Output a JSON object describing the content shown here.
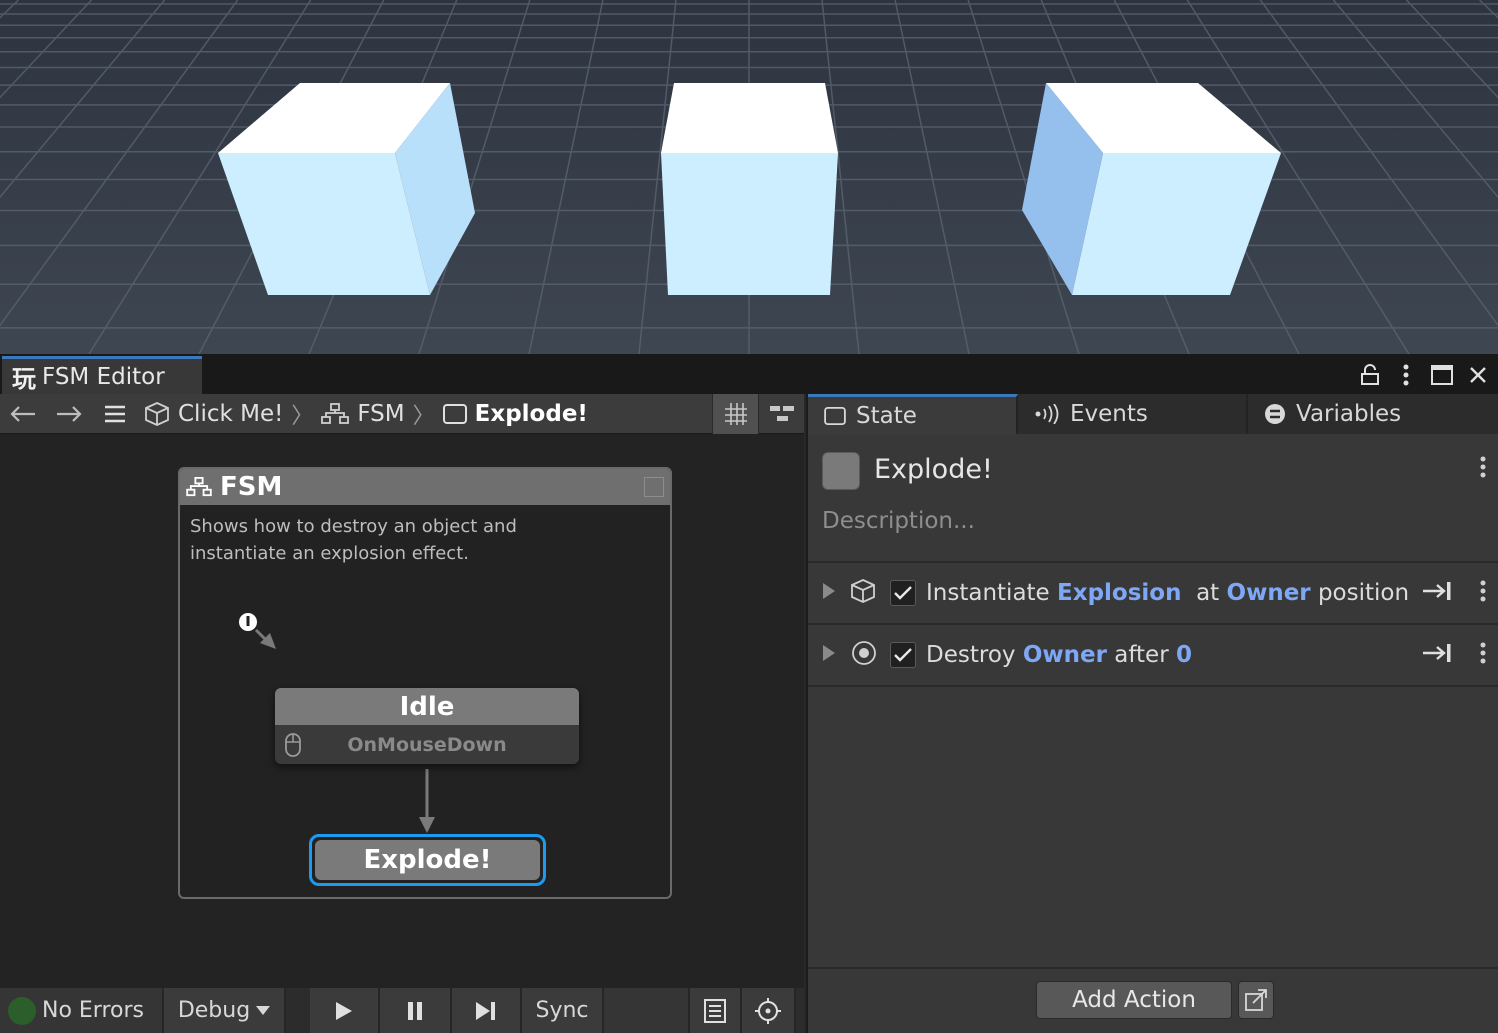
{
  "window": {
    "tab_glyph": "玩",
    "tab_title": "FSM Editor"
  },
  "breadcrumb": {
    "items": [
      "Click Me!",
      "FSM",
      "Explode!"
    ],
    "separator": "〉"
  },
  "fsm": {
    "title": "FSM",
    "description": "Shows how to destroy an object and instantiate an explosion effect."
  },
  "states": {
    "idle": {
      "name": "Idle",
      "event": "OnMouseDown"
    },
    "explode": {
      "name": "Explode!"
    }
  },
  "status": {
    "errors": "No Errors",
    "mode": "Debug",
    "sync": "Sync",
    "dot_color": "#2c5e2c"
  },
  "inspector": {
    "tabs": [
      "State",
      "Events",
      "Variables"
    ],
    "state_name": "Explode!",
    "description_placeholder": "Description...",
    "actions": [
      {
        "parts": [
          "Instantiate ",
          "Explosion",
          "  at ",
          "Owner",
          " position"
        ]
      },
      {
        "parts": [
          "Destroy ",
          "Owner",
          " after ",
          "0"
        ]
      }
    ],
    "add_action": "Add Action"
  },
  "colors": {
    "selection": "#1d9bf0",
    "highlight": "#7ea7f5",
    "tab_accent": "#3a79bb"
  }
}
